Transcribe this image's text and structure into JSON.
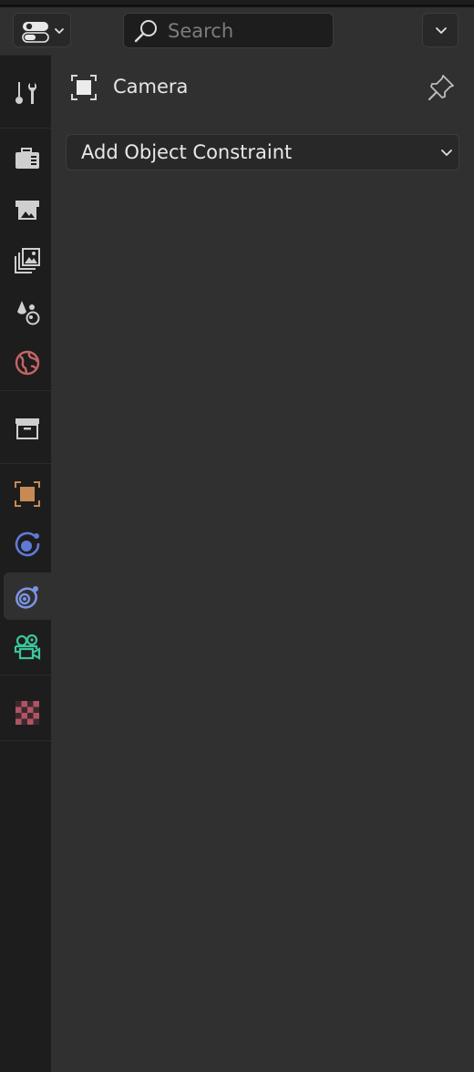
{
  "header": {
    "editor_type_icon": "properties-editor-switch-icon",
    "search": {
      "placeholder": "Search",
      "value": ""
    },
    "options_icon": "chevron-down-icon"
  },
  "tabs": [
    {
      "name": "tool",
      "icon": "tool-settings-icon",
      "active": false
    },
    {
      "name": "render",
      "icon": "render-icon",
      "active": false
    },
    {
      "name": "output",
      "icon": "output-icon",
      "active": false
    },
    {
      "name": "view-layer",
      "icon": "view-layer-icon",
      "active": false
    },
    {
      "name": "scene",
      "icon": "scene-icon",
      "active": false
    },
    {
      "name": "world",
      "icon": "world-icon",
      "active": false
    },
    {
      "name": "collection",
      "icon": "collection-icon",
      "active": false
    },
    {
      "name": "object",
      "icon": "object-icon",
      "active": false
    },
    {
      "name": "physics",
      "icon": "physics-icon",
      "active": false
    },
    {
      "name": "object-constraints",
      "icon": "object-constraint-icon",
      "active": true
    },
    {
      "name": "object-data",
      "icon": "camera-data-icon",
      "active": false
    },
    {
      "name": "texture",
      "icon": "texture-icon",
      "active": false
    }
  ],
  "context": {
    "label": "Camera",
    "icon": "object-icon",
    "pin_icon": "pin-icon"
  },
  "constraints": {
    "add_label": "Add Object Constraint"
  },
  "colors": {
    "panel_bg": "#303030",
    "tab_bg": "#1d1d1d",
    "object_orange": "#c78a55",
    "constraint_blue": "#7b93e2",
    "physics_blue": "#5f7ad6",
    "camera_green": "#3cc59c",
    "world_red": "#c56565",
    "texture_red": "#b25364"
  }
}
